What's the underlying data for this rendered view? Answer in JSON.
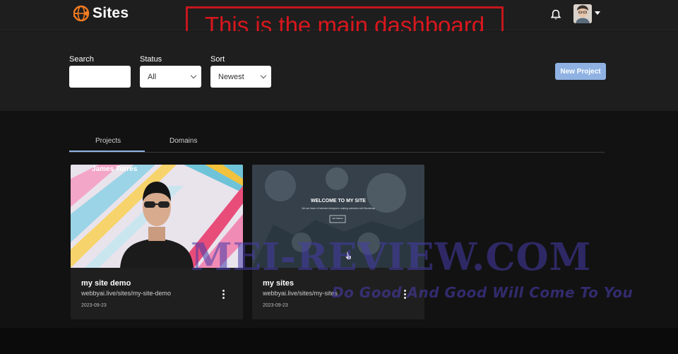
{
  "header": {
    "logo_text": "Sites",
    "notification_icon": "bell-icon",
    "avatar_icon": "user-avatar",
    "menu_icon": "caret-down-icon"
  },
  "annotation": {
    "text": "This is the main dashboard",
    "color": "#c4161c"
  },
  "filters": {
    "search_label": "Search",
    "search_value": "",
    "status_label": "Status",
    "status_value": "All",
    "sort_label": "Sort",
    "sort_value": "Newest",
    "new_project_label": "New Project"
  },
  "tabs": [
    {
      "label": "Projects",
      "active": true
    },
    {
      "label": "Domains",
      "active": false
    }
  ],
  "projects": [
    {
      "thumb_heading": "James Torres",
      "title": "my site demo",
      "url": "webbyai.live/sites/my-site-demo",
      "date": "2023-09-23"
    },
    {
      "thumb_heading": "WELCOME TO MY SITE",
      "thumb_sub": "We are team of talented designers making websites with Bootstrap",
      "thumb_button": "Get Started",
      "title": "my sites",
      "url": "webbyai.live/sites/my-sites",
      "date": "2023-09-23"
    }
  ],
  "watermark": {
    "line1": "MEI-REVIEW.COM",
    "line2": "Do Good And Good Will Come To You"
  },
  "colors": {
    "accent": "#8fb2e3",
    "background": "#121212",
    "panel": "#1e1e1e"
  }
}
